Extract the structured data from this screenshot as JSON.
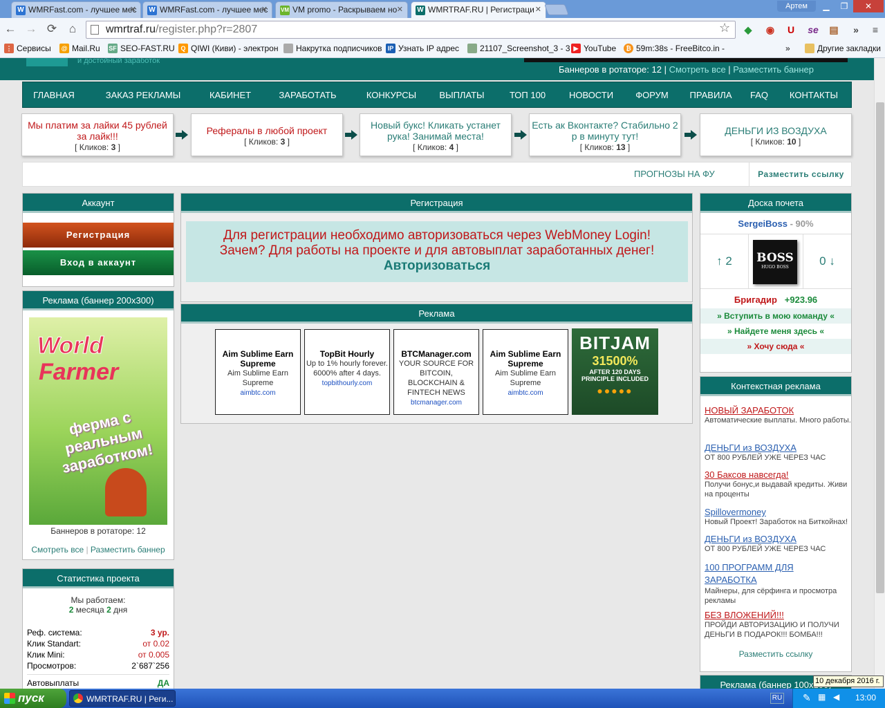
{
  "browser": {
    "tabs": [
      {
        "title": "WMRFast.com - лучшее мес",
        "icon": "W"
      },
      {
        "title": "WMRFast.com - лучшее мес",
        "icon": "W"
      },
      {
        "title": "VM promo - Раскрываем но",
        "icon": "VM"
      },
      {
        "title": "WMRTRAF.RU | Регистраци",
        "icon": "W"
      }
    ],
    "user": "Артем",
    "url_host": "wmrtraf.ru",
    "url_path": "/register.php?r=2807",
    "bookmarks": [
      "Сервисы",
      "Mail.Ru",
      "SEO-FAST.RU",
      "QIWI (Киви) - электрон",
      "Накрутка подписчиков",
      "Узнать IP адрес",
      "21107_Screenshot_3 - 3",
      "YouTube",
      "59m:38s - FreeBitco.in -"
    ],
    "other_bookmarks": "Другие закладки",
    "more": "»"
  },
  "header": {
    "tagline": "и достойный заработок",
    "banners_label": "Баннеров в ротаторе:",
    "banners_count": "12",
    "see_all": "Смотреть все",
    "place_banner": "Разместить баннер"
  },
  "menu": [
    "ГЛАВНАЯ",
    "ЗАКАЗ РЕКЛАМЫ",
    "КАБИНЕТ",
    "ЗАРАБОТАТЬ",
    "КОНКУРСЫ",
    "ВЫПЛАТЫ",
    "ТОП 100",
    "НОВОСТИ",
    "ФОРУМ",
    "ПРАВИЛА",
    "FAQ",
    "КОНТАКТЫ"
  ],
  "teasers": [
    {
      "text": "Мы платим за лайки 45 рублей за лайк!!!",
      "clicks": "3",
      "color": "#c0181a"
    },
    {
      "text": "Рефералы в любой проект",
      "clicks": "3",
      "color": "#c0181a"
    },
    {
      "text": "Новый букс! Кликать устанет рука! Занимай места!",
      "clicks": "4",
      "color": "#2a7d76"
    },
    {
      "text": "Есть ак Вконтакте? Стабильно 2 р в минуту тут!",
      "clicks": "13",
      "color": "#2a7d76"
    },
    {
      "text": "ДЕНЬГИ ИЗ ВОЗДУХА",
      "clicks": "10",
      "color": "#2a7d76"
    }
  ],
  "clicks_label": "Кликов:",
  "linkbar": {
    "text": "ПРОГНОЗЫ НА ФУ",
    "place_link": "Разместить ссылку"
  },
  "account": {
    "title": "Аккаунт",
    "register": "Регистрация",
    "login": "Вход в аккаунт"
  },
  "banner_ad": {
    "title": "Реклама (баннер 200x300)",
    "line1": "World",
    "line2": "Farmer",
    "slogan": "ферма с реальным заработком!",
    "rotator_label": "Баннеров в ротаторе: 12",
    "see_all": "Смотреть все",
    "place": "Разместить баннер"
  },
  "stats": {
    "title": "Статистика проекта",
    "working_label": "Мы работаем:",
    "months": "2",
    "months_word": "месяца",
    "days": "2",
    "days_word": "дня",
    "rows": [
      {
        "label": "Реф. система:",
        "value": "3 ур."
      },
      {
        "label": "Клик Standart:",
        "value": "от 0.02"
      },
      {
        "label": "Клик Mini:",
        "value": "от 0.005"
      },
      {
        "label": "Просмотров:",
        "value": "2`687`256"
      }
    ],
    "autopay_label": "Автовыплаты",
    "autopay_value": "ДА"
  },
  "registration": {
    "title": "Регистрация",
    "line1": "Для регистрации необходимо авторизоваться через WebMoney Login!",
    "line2": "Зачем? Для работы на проекте и для автовыплат заработанных денег!",
    "authorize": "Авторизоваться"
  },
  "ads": {
    "title": "Реклама",
    "items": [
      {
        "title": "Aim Sublime Earn Supreme",
        "desc": "Aim Sublime Earn Supreme",
        "url": "aimbtc.com"
      },
      {
        "title": "TopBit Hourly",
        "desc": "Up to 1% hourly forever. 6000% after 4 days.",
        "url": "topbithourly.com"
      },
      {
        "title": "BTCManager.com",
        "desc": "YOUR SOURCE FOR BITCOIN, BLOCKCHAIN & FINTECH NEWS",
        "url": "btcmanager.com"
      },
      {
        "title": "Aim Sublime Earn Supreme",
        "desc": "Aim Sublime Earn Supreme",
        "url": "aimbtc.com"
      }
    ],
    "bitjam": {
      "name": "BITJAM",
      "percent": "31500%",
      "after": "AFTER 120 DAYS",
      "principle": "PRINCIPLE INCLUDED"
    }
  },
  "honor": {
    "title": "Доска почета",
    "user": "SergeiBoss",
    "percent": "- 90%",
    "up": "↑ 2",
    "down": "0 ↓",
    "logo": "BOSS",
    "logo_sub": "HUGO BOSS",
    "rank": "Бригадир",
    "score": "+923.96",
    "join": "» Вступить в мою команду «",
    "find": "» Найдете меня здесь «",
    "want": "» Хочу сюда «"
  },
  "context_ads": {
    "title": "Контекстная реклама",
    "items": [
      {
        "title": "НОВЫЙ ЗАРАБОТОК",
        "desc": "Автоматические выплаты. Много работы.",
        "color": "#c0181a"
      },
      {
        "title": "ДЕНЬГИ из ВОЗДУХА",
        "desc": "ОТ 800 РУБЛЕЙ УЖЕ ЧЕРЕЗ ЧАС",
        "color": "#2a5fb0"
      },
      {
        "title": "30 Баксов навсегда!",
        "desc": "Получи бонус,и выдавай кредиты. Живи на проценты",
        "color": "#c0181a"
      },
      {
        "title": "Spillovermoney",
        "desc": "Новый Проект! Заработок на Биткойнах!",
        "color": "#2a5fb0"
      },
      {
        "title": "ДЕНЬГИ из ВОЗДУХА",
        "desc": "ОТ 800 РУБЛЕЙ УЖЕ ЧЕРЕЗ ЧАС",
        "color": "#2a5fb0"
      },
      {
        "title": "100 ПРОГРАММ ДЛЯ ЗАРАБОТКА",
        "desc": "Майнеры, для сёрфинга и просмотра рекламы",
        "color": "#2a5fb0"
      },
      {
        "title": "БЕЗ ВЛОЖЕНИЙ!!!",
        "desc": "ПРОЙДИ АВТОРИЗАЦИЮ И ПОЛУЧИ ДЕНЬГИ В ПОДАРОК!!! БОМБА!!!",
        "color": "#c0181a"
      }
    ],
    "place": "Разместить ссылку"
  },
  "banner100": {
    "title": "Реклама (баннер 100x100)"
  },
  "taskbar": {
    "start": "пуск",
    "task": "WMRTRAF.RU | Реги...",
    "lang": "RU",
    "time": "13:00",
    "tooltip": "10 декабря 2016 г."
  }
}
